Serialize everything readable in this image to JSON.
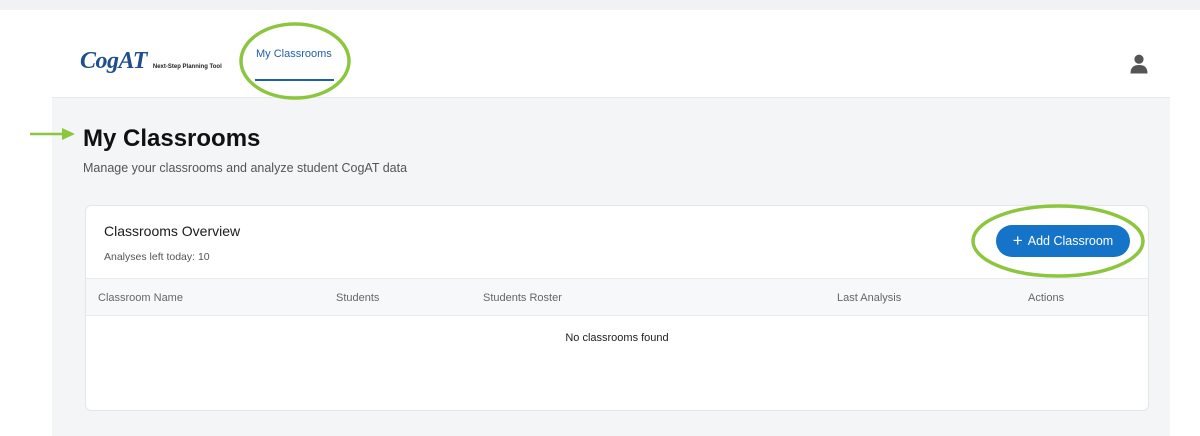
{
  "header": {
    "logo_text": "CogAT",
    "logo_subtitle": "Next-Step Planning Tool",
    "nav_tab_label": "My Classrooms",
    "user_icon": "user-icon"
  },
  "page": {
    "title": "My Classrooms",
    "subtitle": "Manage your classrooms and analyze student CogAT data"
  },
  "overview": {
    "title": "Classrooms Overview",
    "analyses_left": "Analyses left today: 10",
    "add_button_label": "Add Classroom",
    "add_button_icon": "plus-icon"
  },
  "table": {
    "columns": [
      "Classroom Name",
      "Students",
      "Students Roster",
      "Last Analysis",
      "Actions"
    ],
    "empty_message": "No classrooms found"
  },
  "colors": {
    "accent": "#1674c8",
    "annotation": "#8cc63f",
    "logo": "#1f4e8c"
  }
}
